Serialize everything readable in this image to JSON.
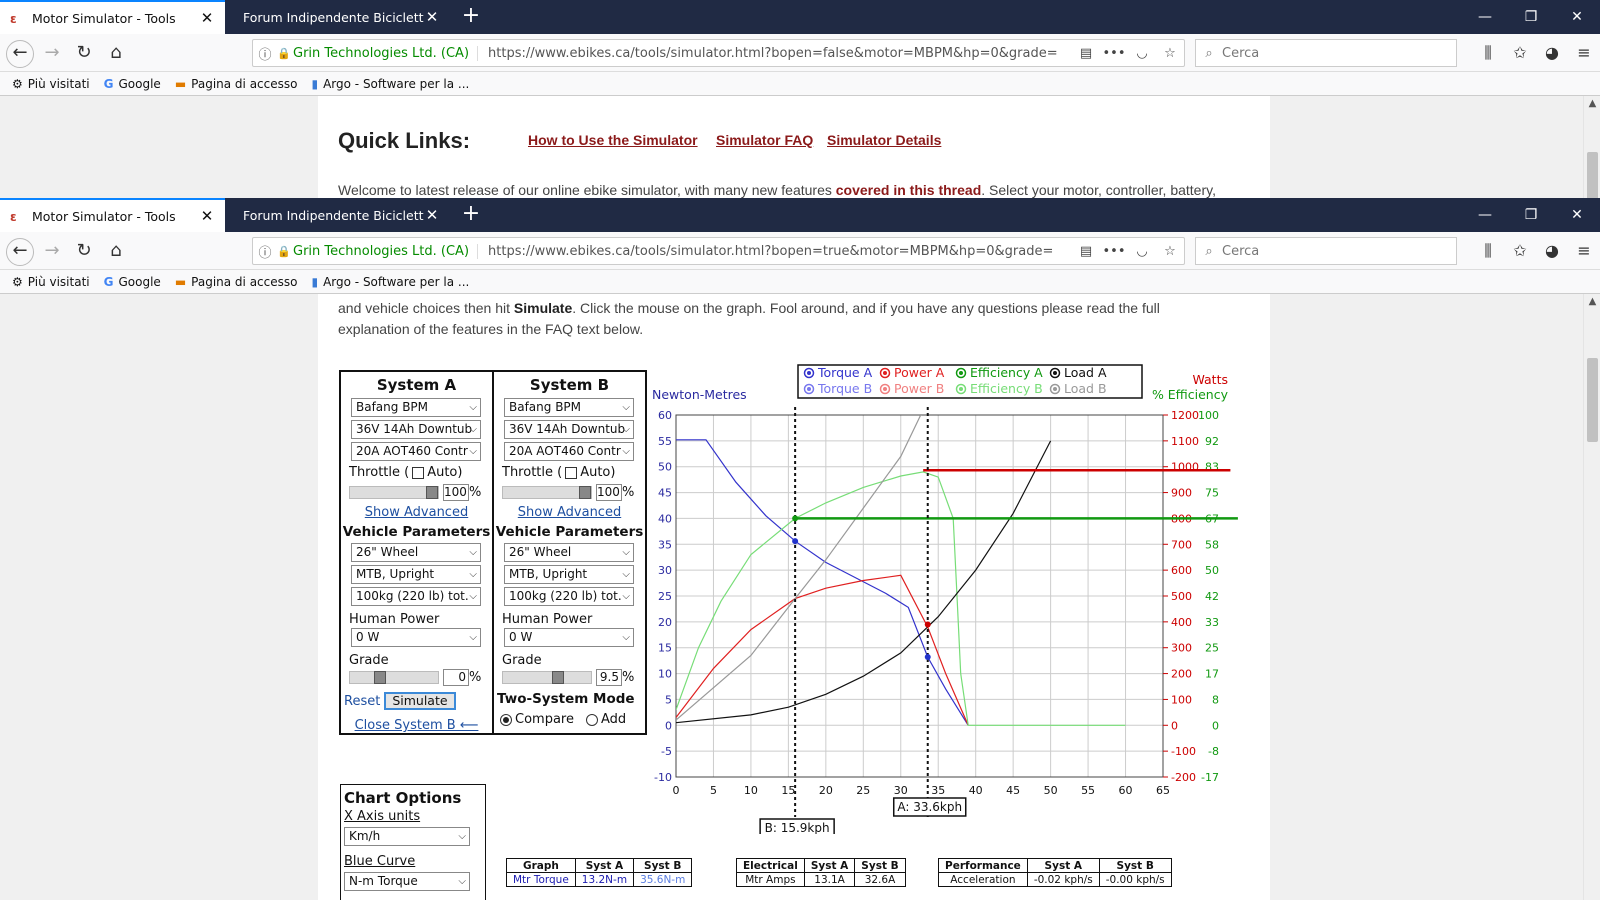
{
  "browser": {
    "tabs": [
      {
        "title": "Motor Simulator - Tools"
      },
      {
        "title": "Forum Indipendente Biciclette Elett"
      }
    ],
    "site_identity": "Grin Technologies Ltd. (CA)",
    "url_top": "https://www.ebikes.ca/tools/simulator.html?bopen=false&motor=MBPM&hp=0&grade=",
    "url_bottom": "https://www.ebikes.ca/tools/simulator.html?bopen=true&motor=MBPM&hp=0&grade=",
    "search_placeholder": "Cerca",
    "bookmarks": [
      "Più visitati",
      "Google",
      "Pagina di accesso",
      "Argo - Software per la ..."
    ]
  },
  "top_page": {
    "quick_links_title": "Quick Links:",
    "links": [
      "How to Use the Simulator",
      "Simulator FAQ",
      "Simulator Details"
    ],
    "welcome_start": "Welcome to latest release of our online ebike simulator, with many new features ",
    "welcome_link": "covered in this thread",
    "welcome_end": ".  Select your motor, controller, battery,"
  },
  "intro": {
    "line1_start": "and vehicle choices then hit ",
    "line1_bold": "Simulate",
    "line1_end": ". Click the mouse on the graph. Fool around, and if you have any questions please read the full",
    "line2": "explanation of the features in the FAQ text below."
  },
  "system_a": {
    "title": "System A",
    "motor": "Bafang BPM",
    "battery": "36V 14Ah Downtub",
    "controller": "20A AOT460 Contr",
    "throttle_label": "Throttle (",
    "auto_label": "Auto)",
    "throttle_value": "100",
    "percent": "%",
    "show_advanced": "Show Advanced",
    "vehicle_params": "Vehicle Parameters",
    "wheel": "26\"  Wheel",
    "posture": "MTB, Upright",
    "weight": "100kg (220 lb) tot.",
    "human_power_label": "Human Power",
    "human_power": "0 W",
    "grade_label": "Grade",
    "grade_value": "0",
    "reset": "Reset",
    "simulate": "Simulate",
    "close_b": "Close System B ⟵"
  },
  "system_b": {
    "title": "System B",
    "motor": "Bafang BPM",
    "battery": "36V 14Ah Downtub",
    "controller": "20A AOT460 Contr",
    "throttle_label": "Throttle (",
    "auto_label": "Auto)",
    "throttle_value": "100",
    "percent": "%",
    "show_advanced": "Show Advanced",
    "vehicle_params": "Vehicle Parameters",
    "wheel": "26\"  Wheel",
    "posture": "MTB, Upright",
    "weight": "100kg (220 lb) tot.",
    "human_power_label": "Human Power",
    "human_power": "0 W",
    "grade_label": "Grade",
    "grade_value": "9.5",
    "two_system_mode": "Two-System Mode",
    "compare": "Compare",
    "add": "Add"
  },
  "chart_options": {
    "title": "Chart Options",
    "x_axis_label": "X Axis units",
    "x_axis_value": "Km/h",
    "blue_curve_label": "Blue Curve",
    "blue_curve_value": "N-m Torque"
  },
  "tables": {
    "graph": {
      "headers": [
        "Graph",
        "Syst A",
        "Syst B"
      ],
      "row": [
        "Mtr Torque",
        "13.2N-m",
        "35.6N-m"
      ]
    },
    "electrical": {
      "headers": [
        "Electrical",
        "Syst A",
        "Syst B"
      ],
      "row": [
        "Mtr Amps",
        "13.1A",
        "32.6A"
      ]
    },
    "performance": {
      "headers": [
        "Performance",
        "Syst A",
        "Syst B"
      ],
      "row": [
        "Acceleration",
        "-0.02 kph/s",
        "-0.00 kph/s"
      ]
    }
  },
  "colors": {
    "torque_a": "#3333cc",
    "torque_b": "#7777ee",
    "power_a": "#e02020",
    "power_b": "#f08080",
    "efficiency_a": "#119911",
    "efficiency_b": "#77dd77",
    "load_a": "#111111",
    "load_b": "#999999",
    "tab_bar": "#202a44"
  },
  "chart_data": {
    "type": "line",
    "legend": [
      {
        "name": "Torque A",
        "color": "#3333cc"
      },
      {
        "name": "Power A",
        "color": "#e02020"
      },
      {
        "name": "Efficiency A",
        "color": "#119911"
      },
      {
        "name": "Load A",
        "color": "#111111"
      },
      {
        "name": "Torque B",
        "color": "#7777ee"
      },
      {
        "name": "Power B",
        "color": "#f08080"
      },
      {
        "name": "Efficiency B",
        "color": "#77dd77"
      },
      {
        "name": "Load B",
        "color": "#999999"
      }
    ],
    "legend_placement": "top",
    "left_axis_label": "Newton-Metres",
    "right_axis_label_watts": "Watts",
    "right_axis_label_eff": "% Efficiency",
    "xlim": [
      0,
      65
    ],
    "x_ticks": [
      0,
      5,
      10,
      15,
      20,
      25,
      30,
      35,
      40,
      45,
      50,
      55,
      60,
      65
    ],
    "ylim_torque": [
      -10,
      60
    ],
    "y_ticks_torque": [
      60,
      55,
      50,
      45,
      40,
      35,
      30,
      25,
      20,
      15,
      10,
      5,
      0,
      -5,
      -10
    ],
    "watts_ticks": [
      1200,
      1100,
      1000,
      900,
      800,
      700,
      600,
      500,
      400,
      300,
      200,
      100,
      0,
      -100,
      -200
    ],
    "eff_ticks": [
      100,
      92,
      83,
      75,
      67,
      58,
      50,
      42,
      33,
      25,
      17,
      8,
      0,
      -8,
      -17
    ],
    "grid": true,
    "markers": [
      {
        "label": "B: 15.9kph",
        "x": 15.9
      },
      {
        "label": "A: 33.6kph",
        "x": 33.6
      }
    ],
    "series": [
      {
        "name": "Torque A",
        "x": [
          0,
          4,
          8,
          12,
          16,
          20,
          24,
          28,
          31,
          33.6,
          36,
          39
        ],
        "y": [
          55.2,
          55.2,
          47,
          40.5,
          35.5,
          31.5,
          28.5,
          25.5,
          22.8,
          13.2,
          7,
          0
        ]
      },
      {
        "name": "Power A",
        "x": [
          0,
          5,
          10,
          15.9,
          20,
          25,
          30,
          33.6,
          36,
          39
        ],
        "y": [
          1.5,
          11,
          18.5,
          24.5,
          26.5,
          28,
          29,
          19,
          10,
          0
        ]
      },
      {
        "name": "Efficiency A",
        "x": [
          0,
          3,
          6,
          10,
          15.9,
          20,
          25,
          30,
          33,
          35,
          37,
          37.5,
          38,
          39,
          60
        ],
        "y": [
          3,
          15,
          24,
          33,
          40,
          43,
          46,
          48.2,
          49,
          48,
          40,
          25,
          10,
          0,
          0
        ]
      },
      {
        "name": "Load A",
        "x": [
          0,
          10,
          15,
          20,
          25,
          30,
          35,
          40,
          45,
          50
        ],
        "y": [
          0.5,
          2,
          3.5,
          6,
          9.5,
          14,
          21,
          30,
          41,
          55
        ]
      },
      {
        "name": "Load B",
        "x": [
          0,
          10,
          15.9,
          20,
          25,
          30,
          33
        ],
        "y": [
          1,
          13.5,
          24.5,
          32,
          42,
          52,
          61
        ]
      },
      {
        "name": "Power A level (W)",
        "x": [
          33,
          74
        ],
        "y": [
          49.3,
          49.3
        ]
      },
      {
        "name": "Efficiency level",
        "x": [
          15.9,
          75
        ],
        "y": [
          40,
          40
        ]
      }
    ],
    "points": [
      {
        "series": "Torque",
        "x": 15.9,
        "y": 35.6
      },
      {
        "series": "Torque",
        "x": 33.6,
        "y": 13.2
      },
      {
        "series": "Power",
        "x": 33.6,
        "y": 19.5
      },
      {
        "series": "Efficiency",
        "x": 15.9,
        "y": 40
      }
    ]
  }
}
